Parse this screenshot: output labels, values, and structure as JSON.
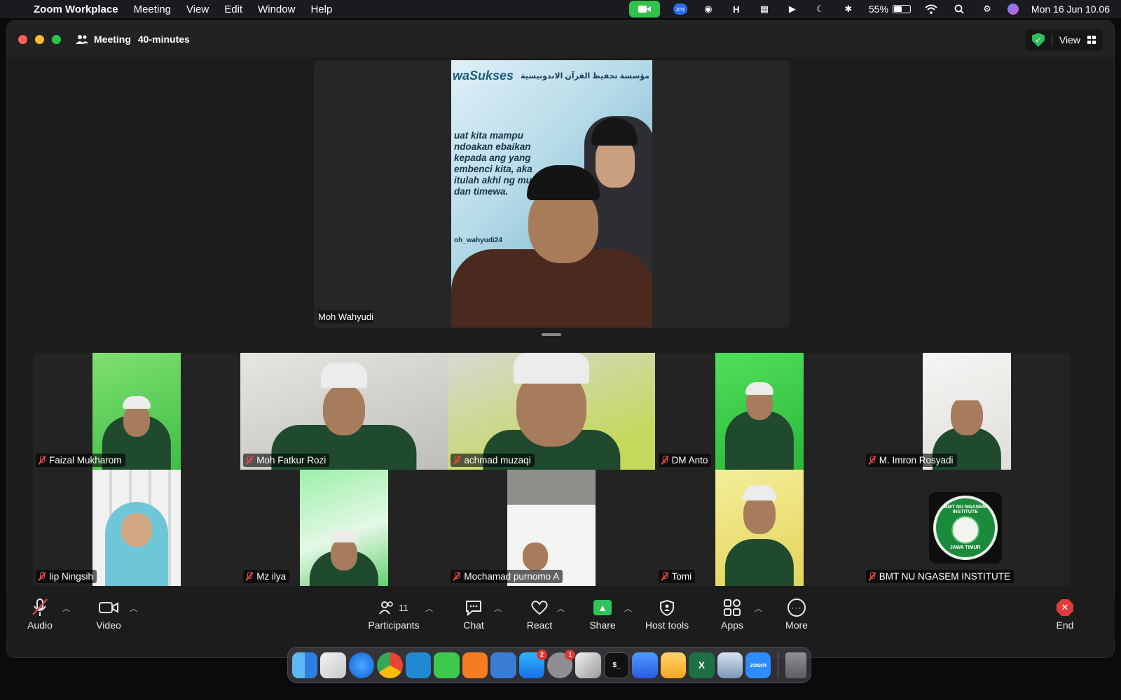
{
  "menubar": {
    "app_name": "Zoom Workplace",
    "menus": [
      "Meeting",
      "View",
      "Edit",
      "Window",
      "Help"
    ],
    "battery_percent": "55%",
    "battery_level": 0.55,
    "datetime": "Mon 16 Jun  10.06",
    "zoom_badge": "zm"
  },
  "window": {
    "title": "Meeting",
    "duration": "40-minutes",
    "view_label": "View"
  },
  "stage": {
    "speaker_name": "Moh Wahyudi",
    "poster_logo": "waSukses",
    "poster_arabic": "مؤسسة تحفيظ القرآن الاندونيسية",
    "poster_text": "uat kita mampu ndoakan ebaikan kepada ang yang embenci kita, aka itulah akhl ng mulia dan timewa.",
    "poster_handle": "oh_wahyudi24"
  },
  "gallery": {
    "participants": [
      {
        "name": "Faizal Mukharom"
      },
      {
        "name": "Moh Fatkur Rozi"
      },
      {
        "name": "achmad muzaqi"
      },
      {
        "name": "DM Anto"
      },
      {
        "name": "M. Imron Rosyadi"
      },
      {
        "name": "Iip Ningsih"
      },
      {
        "name": "Mz ilya"
      },
      {
        "name": "Mochamad purnomo A"
      },
      {
        "name": "Tomi"
      },
      {
        "name": "BMT NU NGASEM INSTITUTE"
      }
    ],
    "bmt_logo_top": "BMT NU NGASEM INSTITUTE",
    "bmt_logo_bottom": "JAWA TIMUR"
  },
  "toolbar": {
    "audio": "Audio",
    "video": "Video",
    "participants": "Participants",
    "participants_count": "11",
    "chat": "Chat",
    "react": "React",
    "share": "Share",
    "host_tools": "Host tools",
    "apps": "Apps",
    "more": "More",
    "end": "End"
  },
  "dock": {
    "badges": {
      "app_store": "2",
      "system_settings": "1"
    },
    "zoom_label": "zoom"
  },
  "colors": {
    "share_green": "#2ec45a",
    "end_red": "#e03c3c",
    "muted_red": "#e94b4b",
    "secure_green": "#2fbf5b"
  }
}
